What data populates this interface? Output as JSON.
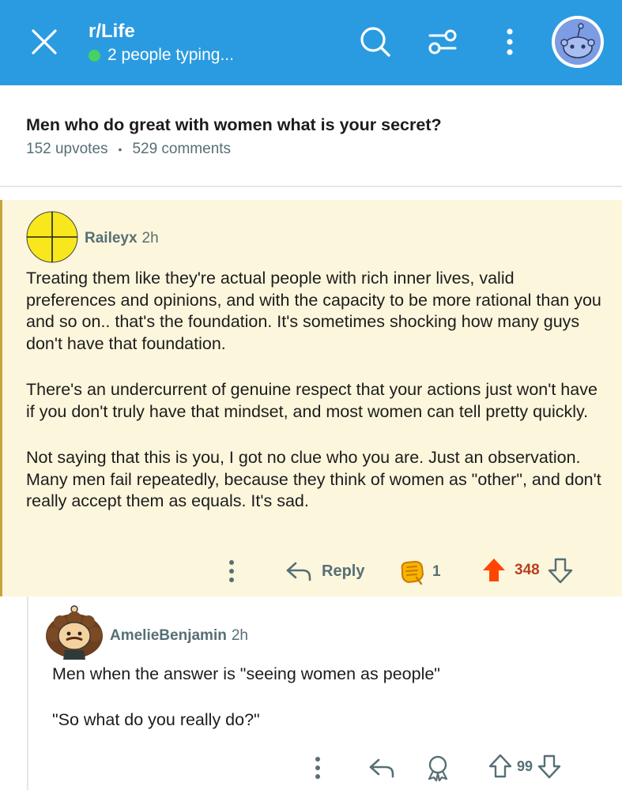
{
  "header": {
    "subreddit": "r/Life",
    "status": "2 people typing...",
    "icons": [
      "close-icon",
      "search-icon",
      "filter-icon",
      "more-vertical-icon",
      "avatar"
    ],
    "colors": {
      "bar": "#2a9be0",
      "online": "#46d160"
    }
  },
  "post": {
    "title": "Men who do great with women what is your secret?",
    "upvotes": "152 upvotes",
    "separator": "•",
    "comments": "529 comments"
  },
  "comments": [
    {
      "author": "Raileyx",
      "time": "2h",
      "highlighted": true,
      "highlight_color": "#fcf6dc",
      "paragraphs": [
        "Treating them like they're actual people with rich inner lives, valid preferences and opinions, and with the capacity to be more rational than you and so on.. that's the foundation. It's sometimes shocking how many guys don't have that foundation.",
        "There's an undercurrent of genuine respect that your actions just won't have if you don't truly have that mindset, and most women can tell pretty quickly.",
        "Not saying that this is you, I got no clue who you are. Just an observation. Many men fail repeatedly, because they think of women as \"other\", and don't really accept them as equals. It's sad."
      ],
      "reply_label": "Reply",
      "award_count": "1",
      "score": "348",
      "upvoted": true,
      "upvote_color": "#ff4500"
    },
    {
      "author": "AmelieBenjamin",
      "time": "2h",
      "paragraphs": [
        "Men when the answer is \"seeing women as people\"",
        "\"So what do you really do?\""
      ],
      "score": "99"
    }
  ]
}
